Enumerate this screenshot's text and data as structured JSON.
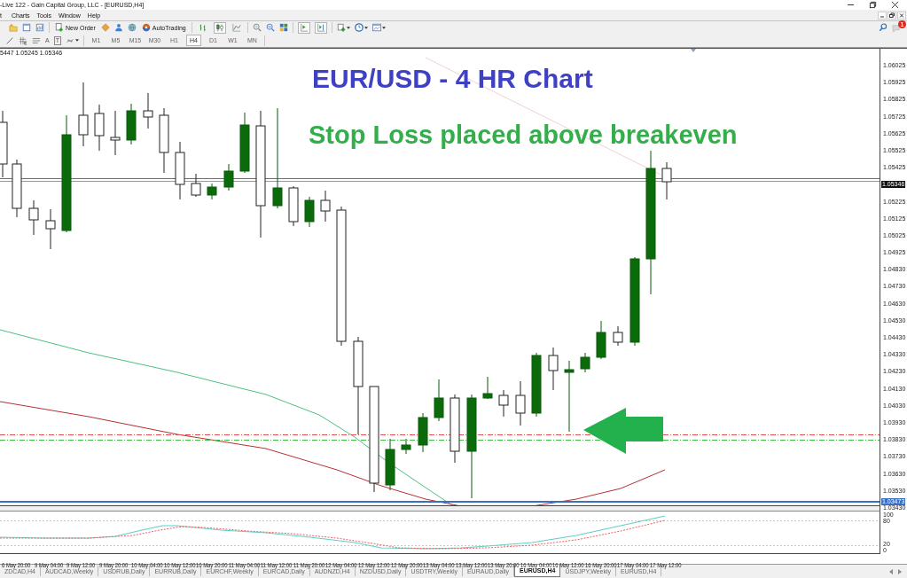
{
  "window": {
    "title": "-Live 122 - Gain Capital Group, LLC - [EURUSD,H4]"
  },
  "menu": [
    "t",
    "Charts",
    "Tools",
    "Window",
    "Help"
  ],
  "toolbar": {
    "new_order": "New Order",
    "auto_trading": "AutoTrading",
    "chart_modes": [
      {
        "selected": false
      },
      {
        "selected": true
      },
      {
        "selected": false
      }
    ],
    "view_toggles": [
      {
        "on": true
      },
      {
        "on": true
      }
    ],
    "notification_count": "1"
  },
  "drawing_tools": {
    "text_tool": "A",
    "label_tool": "T"
  },
  "timeframes": [
    {
      "label": "M1",
      "selected": false
    },
    {
      "label": "M5",
      "selected": false
    },
    {
      "label": "M15",
      "selected": false
    },
    {
      "label": "M30",
      "selected": false
    },
    {
      "label": "H1",
      "selected": false
    },
    {
      "label": "H4",
      "selected": true
    },
    {
      "label": "D1",
      "selected": false
    },
    {
      "label": "W1",
      "selected": false
    },
    {
      "label": "MN",
      "selected": false
    }
  ],
  "chart": {
    "info": "5447 1.05245 1.05346",
    "annotations": [
      {
        "text": "EUR/USD - 4 HR Chart",
        "color": "#3f41c4"
      },
      {
        "text": "Stop Loss placed above breakeven",
        "color": "#34ad4b"
      }
    ],
    "price_axis": [
      {
        "kind": "tick",
        "label": "1.06025"
      },
      {
        "kind": "tick",
        "label": "1.05925"
      },
      {
        "kind": "tick",
        "label": "1.05825"
      },
      {
        "kind": "tick",
        "label": "1.05725"
      },
      {
        "kind": "tick",
        "label": "1.05625"
      },
      {
        "kind": "tick",
        "label": "1.05525"
      },
      {
        "kind": "tick",
        "label": "1.05425"
      },
      {
        "kind": "current",
        "label": "1.05346"
      },
      {
        "kind": "tick",
        "label": "1.05225"
      },
      {
        "kind": "tick",
        "label": "1.05125"
      },
      {
        "kind": "tick",
        "label": "1.05025"
      },
      {
        "kind": "tick",
        "label": "1.04925"
      },
      {
        "kind": "tick",
        "label": "1.04830"
      },
      {
        "kind": "tick",
        "label": "1.04730"
      },
      {
        "kind": "tick",
        "label": "1.04630"
      },
      {
        "kind": "tick",
        "label": "1.04530"
      },
      {
        "kind": "tick",
        "label": "1.04430"
      },
      {
        "kind": "tick",
        "label": "1.04330"
      },
      {
        "kind": "tick",
        "label": "1.04230"
      },
      {
        "kind": "tick",
        "label": "1.04130"
      },
      {
        "kind": "tick",
        "label": "1.04030"
      },
      {
        "kind": "tick",
        "label": "1.03930"
      },
      {
        "kind": "tick",
        "label": "1.03830"
      },
      {
        "kind": "tick",
        "label": "1.03730"
      },
      {
        "kind": "tick",
        "label": "1.03630"
      },
      {
        "kind": "tick",
        "label": "1.03530"
      },
      {
        "kind": "tick",
        "label": "1.03430"
      }
    ],
    "level_label": "1.03473",
    "time_axis": [
      "6 May 20:00",
      "9 May 04:00",
      "9 May 12:00",
      "9 May 20:00",
      "10 May 04:00",
      "10 May 12:00",
      "10 May 20:00",
      "11 May 04:00",
      "11 May 12:00",
      "11 May 20:00",
      "12 May 04:00",
      "12 May 12:00",
      "12 May 20:00",
      "13 May 04:00",
      "13 May 12:00",
      "13 May 20:00",
      "16 May 04:00",
      "16 May 12:00",
      "16 May 20:00",
      "17 May 04:00",
      "17 May 12:00"
    ]
  },
  "oscillator": {
    "levels": [
      "100",
      "80",
      "20",
      "0"
    ]
  },
  "tabs": [
    {
      "label": "ZDCAD,H4",
      "selected": false
    },
    {
      "label": "AUDCAD,Weekly",
      "selected": false
    },
    {
      "label": "USDRUB,Daily",
      "selected": false
    },
    {
      "label": "EURRUB,Daily",
      "selected": false
    },
    {
      "label": "EURCHF,Weekly",
      "selected": false
    },
    {
      "label": "EURCAD,Daily",
      "selected": false
    },
    {
      "label": "AUDNZD,H4",
      "selected": false
    },
    {
      "label": "NZDUSD,Daily",
      "selected": false
    },
    {
      "label": "USDTRY,Weekly",
      "selected": false
    },
    {
      "label": "EURAUD,Daily",
      "selected": false
    },
    {
      "label": "EURUSD,H4",
      "selected": true
    },
    {
      "label": "USDJPY,Weekly",
      "selected": false
    },
    {
      "label": "EURUSD,H4",
      "selected": false
    }
  ]
}
